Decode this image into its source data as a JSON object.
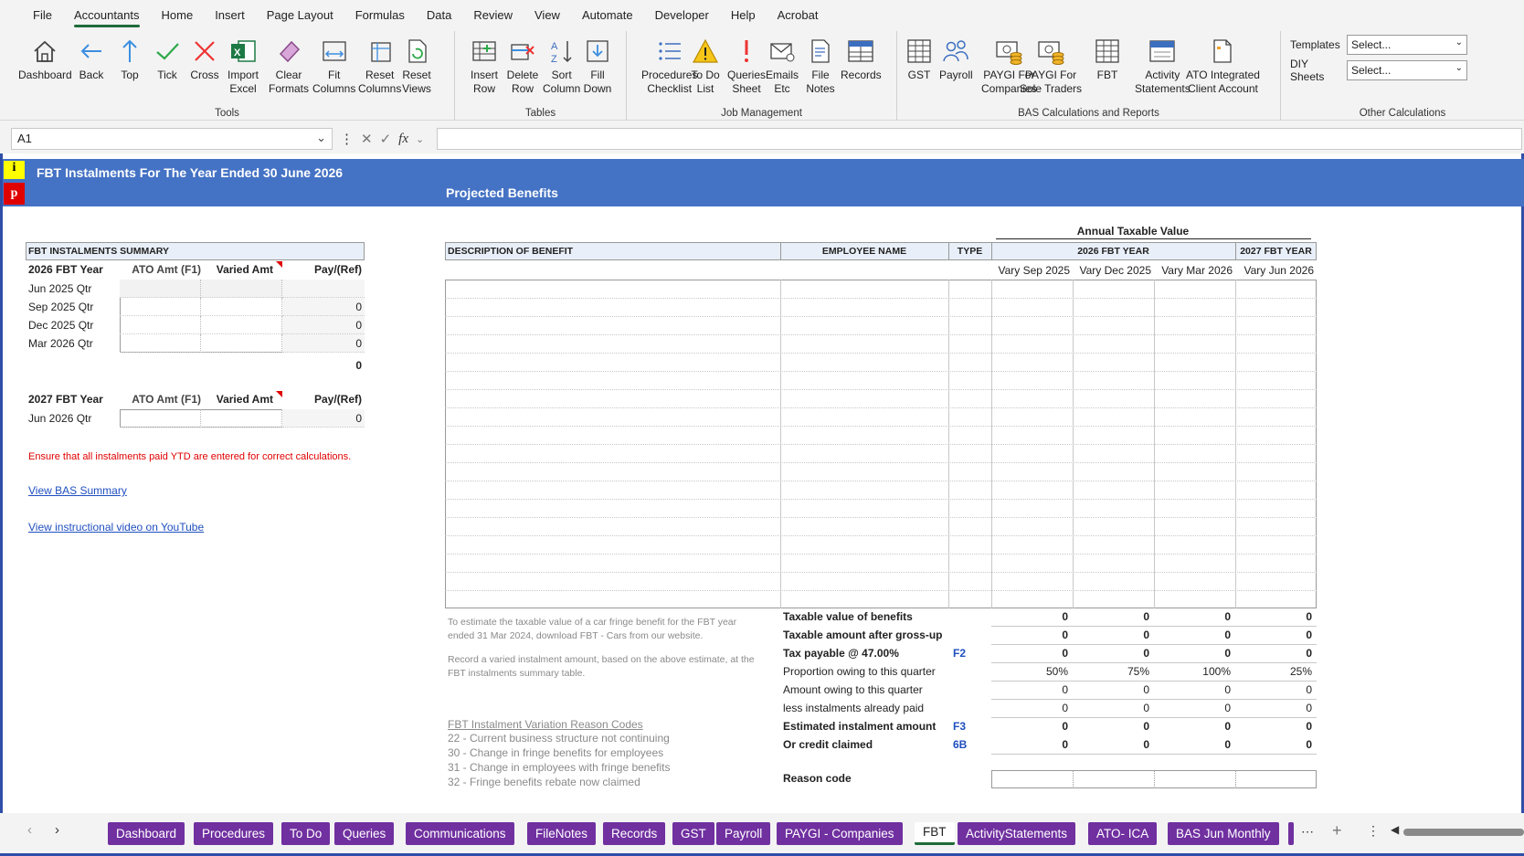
{
  "menu": [
    "File",
    "Accountants",
    "Home",
    "Insert",
    "Page Layout",
    "Formulas",
    "Data",
    "Review",
    "View",
    "Automate",
    "Developer",
    "Help",
    "Acrobat"
  ],
  "menu_active": "Accountants",
  "ribbon": {
    "tools": {
      "label": "Tools",
      "buttons": [
        [
          "Dashboard",
          ""
        ],
        [
          "Back",
          ""
        ],
        [
          "Top",
          ""
        ],
        [
          "Tick",
          ""
        ],
        [
          "Cross",
          ""
        ],
        [
          "Import",
          "Excel"
        ],
        [
          "Clear",
          "Formats"
        ],
        [
          "Fit",
          "Columns"
        ],
        [
          "Reset",
          "Columns"
        ],
        [
          "Reset",
          "Views"
        ]
      ]
    },
    "tables": {
      "label": "Tables",
      "buttons": [
        [
          "Insert",
          "Row"
        ],
        [
          "Delete",
          "Row"
        ],
        [
          "Sort",
          "Column"
        ],
        [
          "Fill",
          "Down"
        ]
      ]
    },
    "job": {
      "label": "Job Management",
      "buttons": [
        [
          "Procedures",
          "Checklist"
        ],
        [
          "To Do",
          "List"
        ],
        [
          "Queries",
          "Sheet"
        ],
        [
          "Emails",
          "Etc"
        ],
        [
          "File",
          "Notes"
        ],
        [
          "Records",
          ""
        ]
      ]
    },
    "bas": {
      "label": "BAS Calculations and Reports",
      "buttons": [
        [
          "GST",
          ""
        ],
        [
          "Payroll",
          ""
        ],
        [
          "PAYGI For",
          "Companies"
        ],
        [
          "PAYGI For",
          "Sole Traders"
        ],
        [
          "FBT",
          ""
        ],
        [
          "Activity",
          "Statements"
        ],
        [
          "ATO Integrated",
          "Client Account"
        ]
      ]
    },
    "other": {
      "label": "Other Calculations",
      "templates_label": "Templates",
      "templates_value": "Select...",
      "diy_label": "DIY Sheets",
      "diy_value": "Select..."
    }
  },
  "namebox": "A1",
  "sheet": {
    "i_marker": "i",
    "p_marker": "p",
    "title": "FBT Instalments For The Year Ended 30 June 2026",
    "subtitle": "Projected Benefits",
    "summary": {
      "heading": "FBT INSTALMENTS SUMMARY",
      "year1": {
        "label": "2026 FBT Year",
        "col1": "ATO Amt  (F1)",
        "col2": "Varied Amt",
        "col3": "Pay/(Ref)",
        "rows": [
          {
            "q": "Jun 2025 Qtr",
            "pay": ""
          },
          {
            "q": "Sep 2025 Qtr",
            "pay": "0"
          },
          {
            "q": "Dec 2025 Qtr",
            "pay": "0"
          },
          {
            "q": "Mar 2026 Qtr",
            "pay": "0"
          }
        ],
        "total": "0"
      },
      "year2": {
        "label": "2027 FBT Year",
        "col1": "ATO Amt  (F1)",
        "col2": "Varied Amt",
        "col3": "Pay/(Ref)",
        "rows": [
          {
            "q": "Jun 2026 Qtr",
            "pay": "0"
          }
        ]
      },
      "warning": "Ensure that all instalments paid YTD are entered for correct calculations.",
      "link1": "View BAS Summary",
      "link2": "View instructional video on YouTube"
    },
    "benefits": {
      "annual_label": "Annual Taxable Value",
      "col_desc": "DESCRIPTION OF BENEFIT",
      "col_emp": "EMPLOYEE NAME",
      "col_type": "TYPE",
      "year2026": "2026 FBT YEAR",
      "year2027": "2027 FBT YEAR",
      "vary": [
        "Vary Sep 2025",
        "Vary Dec 2025",
        "Vary Mar 2026",
        "Vary Jun 2026"
      ],
      "note1": "To estimate the taxable value of a car fringe benefit for the FBT year ended 31 Mar 2024, download FBT - Cars from our website.",
      "note2": "Record a varied instalment amount, based on the above estimate, at the FBT instalments summary table.",
      "reason_title": "FBT Instalment Variation Reason Codes",
      "reasons": [
        "22 - Current business structure not continuing",
        "30 - Change in fringe benefits for employees",
        "31 - Change in employees with fringe benefits",
        "32 - Fringe benefits rebate now claimed"
      ],
      "calc": [
        {
          "label": "Taxable value of benefits",
          "code": "",
          "bold": true,
          "vals": [
            "0",
            "0",
            "0",
            "0"
          ]
        },
        {
          "label": "Taxable amount after gross-up",
          "code": "",
          "bold": true,
          "vals": [
            "0",
            "0",
            "0",
            "0"
          ]
        },
        {
          "label": "Tax payable @ 47.00%",
          "code": "F2",
          "bold": true,
          "vals": [
            "0",
            "0",
            "0",
            "0"
          ]
        },
        {
          "label": "Proportion owing to this quarter",
          "code": "",
          "bold": false,
          "vals": [
            "50%",
            "75%",
            "100%",
            "25%"
          ]
        },
        {
          "label": "Amount owing to this quarter",
          "code": "",
          "bold": false,
          "vals": [
            "0",
            "0",
            "0",
            "0"
          ]
        },
        {
          "label": "less instalments already paid",
          "code": "",
          "bold": false,
          "vals": [
            "0",
            "0",
            "0",
            "0"
          ]
        },
        {
          "label": "Estimated instalment amount",
          "code": "F3",
          "bold": true,
          "vals": [
            "0",
            "0",
            "0",
            "0"
          ]
        },
        {
          "label": "Or credit claimed",
          "code": "6B",
          "bold": true,
          "vals": [
            "0",
            "0",
            "0",
            "0"
          ]
        }
      ],
      "reason_code_label": "Reason code"
    }
  },
  "tabs": [
    "Dashboard",
    "Procedures",
    "To Do",
    "Queries",
    "Communications",
    "FileNotes",
    "Records",
    "GST",
    "Payroll",
    "PAYGI - Companies",
    "FBT",
    "ActivityStatements",
    "ATO- ICA",
    "BAS Jun Monthly"
  ],
  "active_tab": "FBT"
}
